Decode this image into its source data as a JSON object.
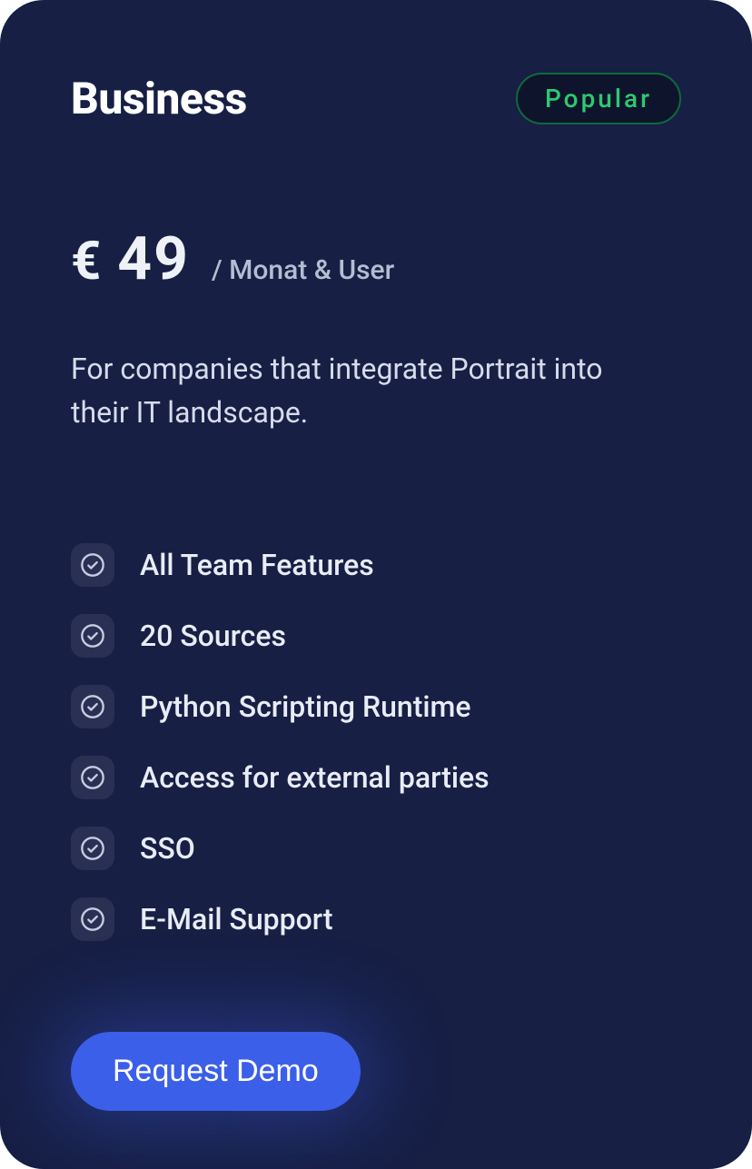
{
  "plan": {
    "title": "Business",
    "badge": "Popular",
    "currency": "€",
    "amount": "49",
    "period": "/ Monat & User",
    "description": "For companies that integrate Portrait into their IT landscape.",
    "features": [
      {
        "label": "All Team Features"
      },
      {
        "label": "20 Sources"
      },
      {
        "label": "Python Scripting Runtime"
      },
      {
        "label": "Access for external parties"
      },
      {
        "label": "SSO"
      },
      {
        "label": "E-Mail Support"
      }
    ],
    "cta_label": "Request Demo"
  }
}
